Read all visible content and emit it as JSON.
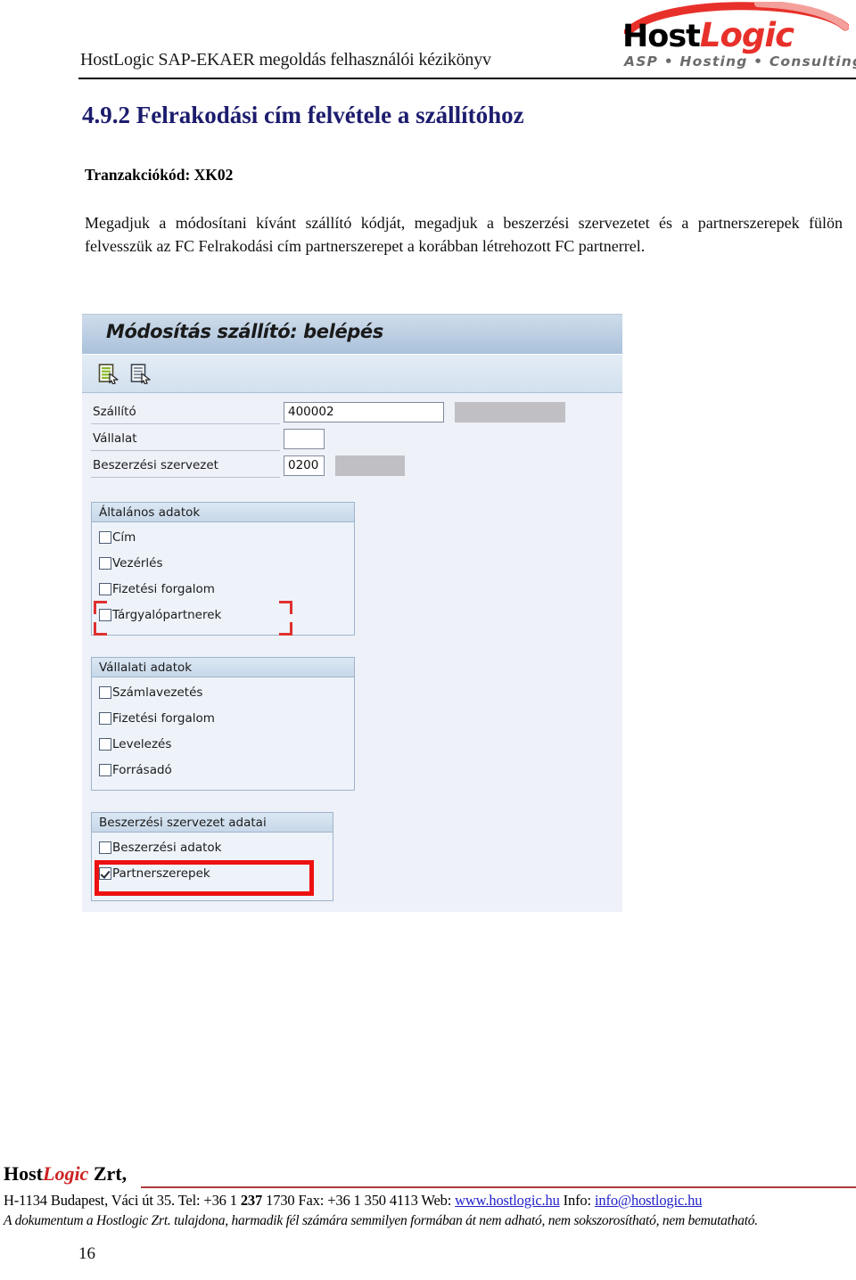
{
  "header": {
    "document_title": "HostLogic SAP-EKAER megoldás felhasználói kézikönyv",
    "logo": {
      "word_host": "Host",
      "word_logic": "Logic",
      "tagline": "ASP  •  Hosting  •  Consulting",
      "arc_color": "#e8302a",
      "logic_color": "#e8302a",
      "tagline_color": "#6b6b6b"
    }
  },
  "content": {
    "section_heading": "4.9.2 Felrakodási cím felvétele a szállítóhoz",
    "transaction_line": "Tranzakciókód: XK02",
    "intro_paragraph": "Megadjuk a módosítani kívánt szállító kódját, megadjuk a beszerzési szervezetet és a partnerszerepek fülön felvesszük az FC Felrakodási cím partnerszerepet a korábban létrehozott FC partnerrel.",
    "heading_color": "#1c1c6e"
  },
  "sap_screenshot": {
    "window_title": "Módosítás szállító: belépés",
    "toolbar": {
      "icons": [
        {
          "name": "create-document-green-icon",
          "label": ""
        },
        {
          "name": "display-document-gray-icon",
          "label": ""
        }
      ]
    },
    "fields": [
      {
        "label": "Szállító",
        "value": "400002",
        "input_width": 180,
        "has_swatch": true,
        "swatch_width": 124
      },
      {
        "label": "Vállalat",
        "value": "",
        "input_width": 46,
        "has_swatch": false,
        "swatch_width": 0
      },
      {
        "label": "Beszerzési szervezet",
        "value": "0200",
        "input_width": 46,
        "has_swatch": true,
        "swatch_width": 78
      }
    ],
    "groups": [
      {
        "title": "Általános adatok",
        "items": [
          {
            "label": "Cím",
            "checked": false,
            "bracketed": false
          },
          {
            "label": "Vezérlés",
            "checked": false,
            "bracketed": false
          },
          {
            "label": "Fizetési forgalom",
            "checked": false,
            "bracketed": false
          },
          {
            "label": "Tárgyalópartnerek",
            "checked": false,
            "bracketed": true
          }
        ]
      },
      {
        "title": "Vállalati adatok",
        "items": [
          {
            "label": "Számlavezetés",
            "checked": false,
            "bracketed": false
          },
          {
            "label": "Fizetési forgalom",
            "checked": false,
            "bracketed": false
          },
          {
            "label": "Levelezés",
            "checked": false,
            "bracketed": false
          },
          {
            "label": "Forrásadó",
            "checked": false,
            "bracketed": false
          }
        ]
      },
      {
        "title": "Beszerzési szervezet adatai",
        "items": [
          {
            "label": "Beszerzési adatok",
            "checked": false,
            "bracketed": false
          },
          {
            "label": "Partnerszerepek",
            "checked": true,
            "bracketed": false
          }
        ]
      }
    ],
    "annotations": {
      "highlight_color": "#ee1111",
      "bracket_color": "#e03030",
      "highlighted_item": "Partnerszerepek"
    }
  },
  "footer": {
    "brand_host": "Host",
    "brand_logic": "Logic",
    "brand_suffix": " Zrt,",
    "contact_pre": "H-1134 Budapest, Váci út 35. Tel: +36 1 ",
    "contact_bold": "237",
    "contact_mid": " 1730 Fax: +36 1 350 4113 Web: ",
    "contact_web": "www.hostlogic.hu",
    "contact_info_label": " Info: ",
    "contact_email": "info@hostlogic.hu",
    "disclaimer": "A dokumentum a Hostlogic Zrt. tulajdona, harmadik fél számára semmilyen formában át nem adható, nem sokszorosítható, nem bemutatható.",
    "page_number": "16",
    "rule_color": "#b03a3a",
    "link_color": "#2222cc"
  }
}
